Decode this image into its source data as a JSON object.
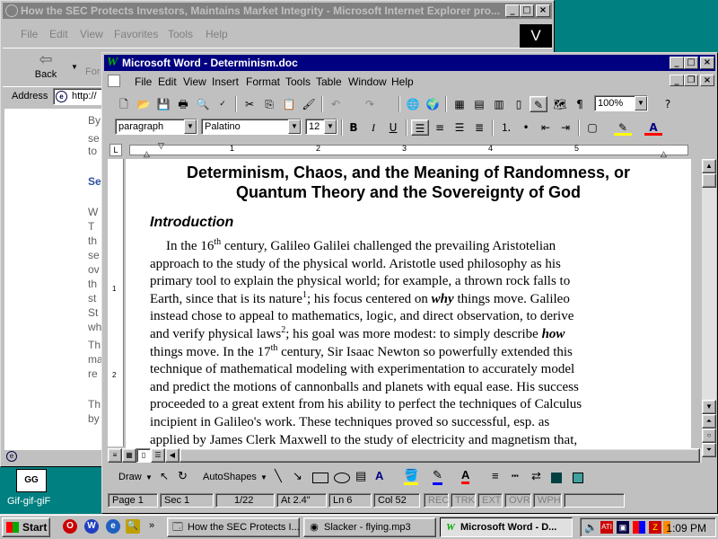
{
  "ie": {
    "title": "How the SEC Protects Investors, Maintains Market Integrity - Microsoft Internet Explorer pro...",
    "menu": [
      "File",
      "Edit",
      "View",
      "Favorites",
      "Tools",
      "Help"
    ],
    "logo": "V",
    "back_label": "Back",
    "forward_label": "For",
    "address_label": "Address",
    "address_value": "http://",
    "page_fragments": [
      "By",
      "se",
      "to",
      "Se",
      "W",
      "T",
      "th",
      "se",
      "ov",
      "th",
      "st",
      "St",
      "wh",
      "Th",
      "ma",
      "re",
      "Th",
      "by"
    ]
  },
  "word": {
    "title": "Microsoft Word - Determinism.doc",
    "menu": [
      "File",
      "Edit",
      "View",
      "Insert",
      "Format",
      "Tools",
      "Table",
      "Window",
      "Help"
    ],
    "style_value": "paragraph",
    "font_value": "Palatino",
    "size_value": "12",
    "zoom_value": "100%",
    "ruler_numbers": [
      "1",
      "2",
      "3",
      "4",
      "5"
    ],
    "doc": {
      "title_line1": "Determinism, Chaos, and the Meaning of Randomness, or",
      "title_line2": "Quantum Theory and the Sovereignty of God",
      "heading": "Introduction",
      "lines": [
        [
          "In the 16",
          "th",
          " century, Galileo Galilei challenged the prevailing Aristotelian"
        ],
        [
          "approach to the study of the physical world.  Aristotle used philosophy as his"
        ],
        [
          "primary tool to explain the physical world; for example, a thrown rock falls to"
        ],
        [
          "Earth, since that is its nature",
          "1",
          "; his focus centered on ",
          "why",
          " things move.  Galileo"
        ],
        [
          "instead chose to appeal to mathematics, logic, and direct observation, to derive"
        ],
        [
          "and verify physical laws",
          "2",
          "; his goal was more modest: to simply describe ",
          "how"
        ],
        [
          "things move.  In the 17",
          "th",
          " century, Sir Isaac Newton so powerfully extended this"
        ],
        [
          "technique of mathematical modeling with experimentation to accurately model"
        ],
        [
          "and predict the motions of cannonballs and planets with equal ease.  His success"
        ],
        [
          "proceeded to a great extent from his ability to perfect the techniques of Calculus"
        ],
        [
          "incipient in Galileo's work.  These techniques proved so successful, esp. as"
        ],
        [
          "applied by James Clerk Maxwell to the study of electricity and magnetism that,"
        ]
      ]
    },
    "draw_label": "Draw",
    "autoshapes_label": "AutoShapes",
    "status": {
      "page": "Page  1",
      "sec": "Sec  1",
      "pages": "1/22",
      "at": "At  2.4\"",
      "ln": "Ln  6",
      "col": "Col  52",
      "rec": "REC",
      "trk": "TRK",
      "ext": "EXT",
      "ovr": "OVR",
      "wph": "WPH"
    }
  },
  "desktop_icon_label": "Gif-gif-giF",
  "desktop_icon_glyph": "GG",
  "taskbar": {
    "start": "Start",
    "tasks": [
      "How the SEC Protects I...",
      "Slacker - flying.mp3",
      "Microsoft Word - D..."
    ],
    "clock": "1:09 PM"
  }
}
